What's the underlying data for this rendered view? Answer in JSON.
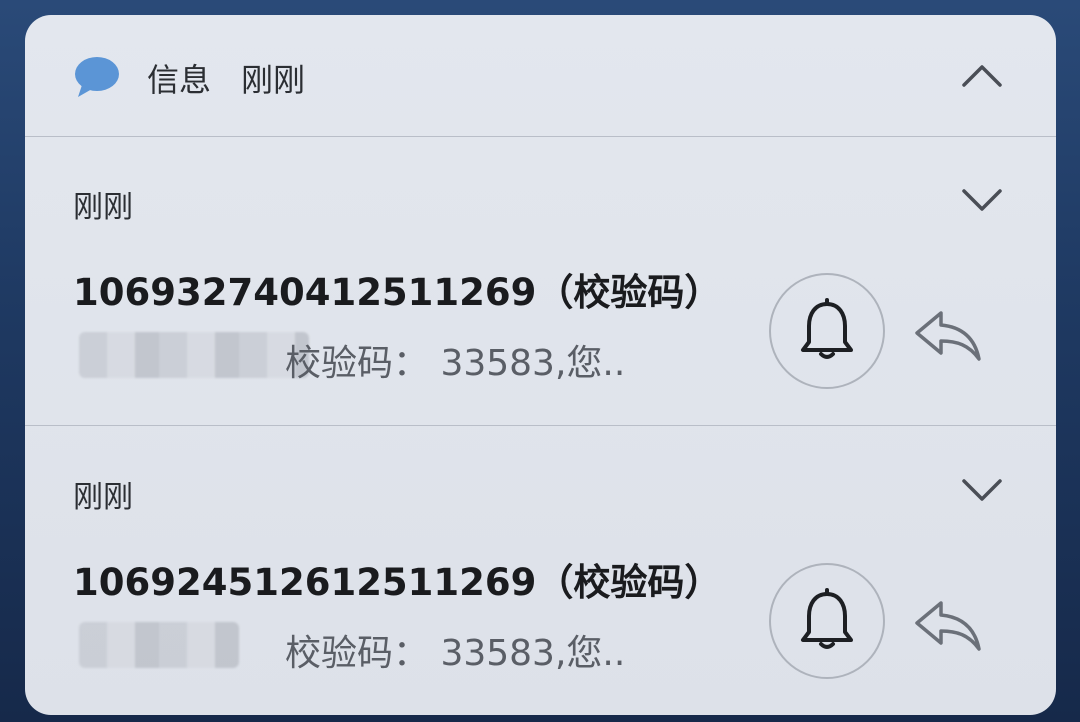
{
  "header": {
    "app_name": "信息",
    "time": "刚刚",
    "app_icon": "message-bubble-icon",
    "collapse_icon": "chevron-up-icon"
  },
  "notifications": [
    {
      "time": "刚刚",
      "sender": "106932740412511269（校验码）",
      "preview": "校验码： 33583,您..",
      "bell_icon": "bell-icon",
      "reply_icon": "reply-icon",
      "expand_icon": "chevron-down-icon"
    },
    {
      "time": "刚刚",
      "sender": "106924512612511269（校验码）",
      "preview": "校验码： 33583,您..",
      "bell_icon": "bell-icon",
      "reply_icon": "reply-icon",
      "expand_icon": "chevron-down-icon"
    }
  ],
  "colors": {
    "card_bg": "#e2e6ed",
    "icon_blue": "#5b95d6",
    "text_primary": "#1a1b1e",
    "text_secondary": "#5a5e66"
  }
}
